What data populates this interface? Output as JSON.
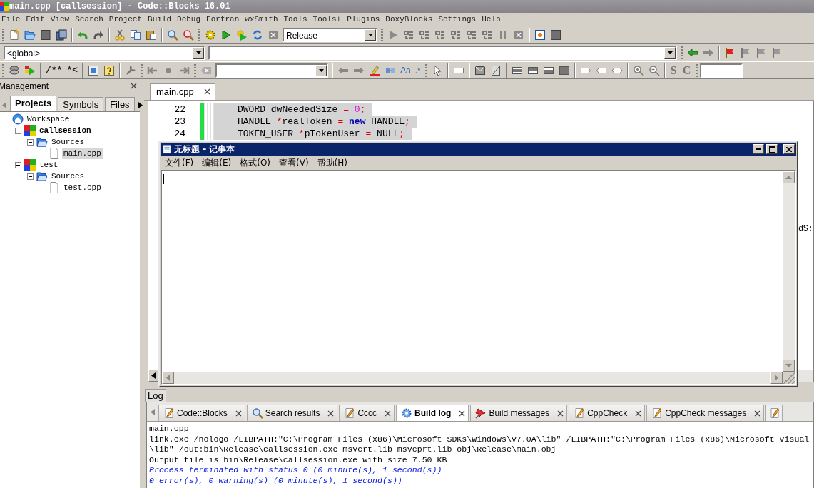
{
  "window": {
    "title": "main.cpp [callsession] - Code::Blocks 16.01"
  },
  "menu": [
    "File",
    "Edit",
    "View",
    "Search",
    "Project",
    "Build",
    "Debug",
    "Fortran",
    "wxSmith",
    "Tools",
    "Tools+",
    "Plugins",
    "DoxyBlocks",
    "Settings",
    "Help"
  ],
  "toolbars": {
    "build_target": "Release",
    "scope": "<global>",
    "comment_buttons": [
      "/**",
      "*<"
    ],
    "search_options": [
      "Aa",
      ".*"
    ],
    "class_buttons": [
      "S",
      "C"
    ]
  },
  "management": {
    "title": "Management",
    "tabs": [
      {
        "label": "Projects",
        "selected": true
      },
      {
        "label": "Symbols",
        "selected": false
      },
      {
        "label": "Files",
        "selected": false
      }
    ],
    "tree": [
      {
        "label": "Workspace",
        "kind": "workspace",
        "selected": false,
        "children": [
          {
            "label": "callsession",
            "kind": "project",
            "active": true,
            "expanded": true,
            "selected": false,
            "children": [
              {
                "label": "Sources",
                "kind": "folder",
                "expanded": true,
                "selected": false,
                "children": [
                  {
                    "label": "main.cpp",
                    "kind": "file",
                    "selected": true
                  }
                ]
              }
            ]
          },
          {
            "label": "test",
            "kind": "project",
            "active": false,
            "expanded": true,
            "selected": false,
            "children": [
              {
                "label": "Sources",
                "kind": "folder",
                "expanded": true,
                "selected": false,
                "children": [
                  {
                    "label": "test.cpp",
                    "kind": "file",
                    "selected": false
                  }
                ]
              }
            ]
          }
        ]
      }
    ]
  },
  "editor": {
    "tabs": [
      {
        "label": "main.cpp",
        "selected": true
      }
    ],
    "lines": [
      {
        "number": "22",
        "tokens": [
          {
            "text": "DWORD dwNeededSize ",
            "kind": "plain"
          },
          {
            "text": "= ",
            "kind": "operator"
          },
          {
            "text": "0",
            "kind": "number"
          },
          {
            "text": ";",
            "kind": "operator"
          }
        ]
      },
      {
        "number": "23",
        "tokens": [
          {
            "text": "HANDLE ",
            "kind": "plain"
          },
          {
            "text": "*",
            "kind": "operator"
          },
          {
            "text": "realToken ",
            "kind": "plain"
          },
          {
            "text": "= ",
            "kind": "operator"
          },
          {
            "text": "new",
            "kind": "keyword"
          },
          {
            "text": " HANDLE",
            "kind": "plain"
          },
          {
            "text": ";",
            "kind": "operator"
          }
        ]
      },
      {
        "number": "24",
        "tokens": [
          {
            "text": "TOKEN_USER ",
            "kind": "plain"
          },
          {
            "text": "*",
            "kind": "operator"
          },
          {
            "text": "pTokenUser ",
            "kind": "plain"
          },
          {
            "text": "=",
            "kind": "operator"
          },
          {
            "text": " NULL",
            "kind": "plain"
          },
          {
            "text": ";",
            "kind": "operator"
          }
        ]
      }
    ],
    "fragment": "dS:"
  },
  "log": {
    "title": "Log",
    "tabs": [
      {
        "label": "Code::Blocks",
        "kind": "text",
        "selected": false
      },
      {
        "label": "Search results",
        "kind": "search",
        "selected": false
      },
      {
        "label": "Cccc",
        "kind": "text",
        "selected": false
      },
      {
        "label": "Build log",
        "kind": "build",
        "selected": true
      },
      {
        "label": "Build messages",
        "kind": "messages",
        "selected": false
      },
      {
        "label": "CppCheck",
        "kind": "text",
        "selected": false
      },
      {
        "label": "CppCheck messages",
        "kind": "text",
        "selected": false
      }
    ],
    "lines": [
      {
        "text": "main.cpp",
        "kind": "normal"
      },
      {
        "text": "link.exe /nologo /LIBPATH:\"C:\\Program Files (x86)\\Microsoft SDKs\\Windows\\v7.0A\\lib\" /LIBPATH:\"C:\\Program Files (x86)\\Microsoft Visual",
        "kind": "normal"
      },
      {
        "text": "\\lib\" /out:bin\\Release\\callsession.exe msvcrt.lib msvcprt.lib obj\\Release\\main.obj",
        "kind": "normal"
      },
      {
        "text": "Output file is bin\\Release\\callsession.exe with size 7.50 KB",
        "kind": "normal"
      },
      {
        "text": "Process terminated with status 0 (0 minute(s), 1 second(s))",
        "kind": "status"
      },
      {
        "text": "0 error(s), 0 warning(s) (0 minute(s), 1 second(s))",
        "kind": "status"
      }
    ]
  },
  "notepad": {
    "title": "无标题 - 记事本",
    "menu": [
      "文件(F)",
      "编辑(E)",
      "格式(O)",
      "查看(V)",
      "帮助(H)"
    ]
  }
}
